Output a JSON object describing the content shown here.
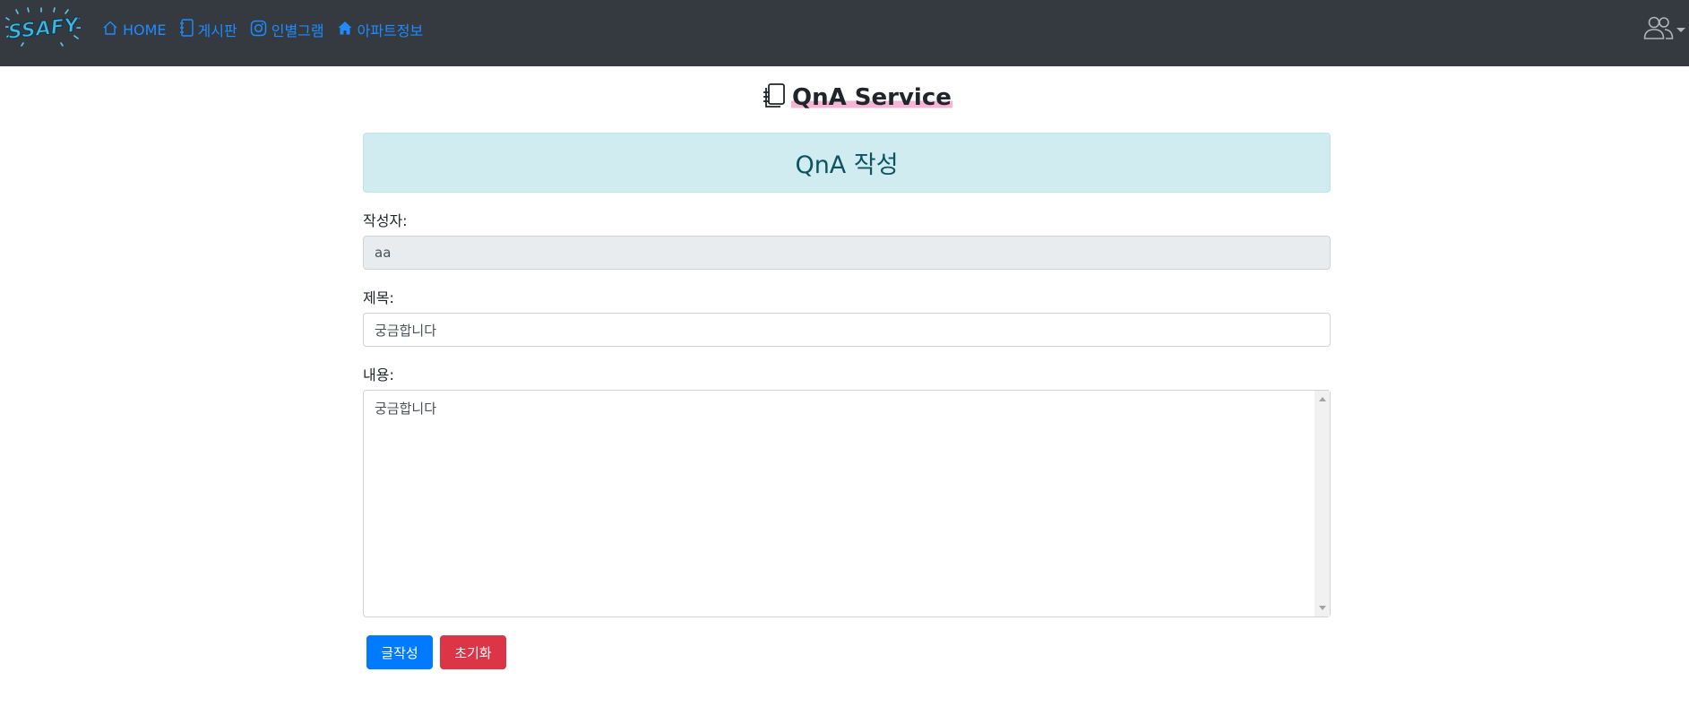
{
  "navbar": {
    "logo_text": "SSAFY",
    "links": [
      {
        "label": "HOME",
        "icon": "house-icon"
      },
      {
        "label": "게시판",
        "icon": "notebook-icon"
      },
      {
        "label": "인별그램",
        "icon": "instagram-icon"
      },
      {
        "label": "아파트정보",
        "icon": "house-fill-icon"
      }
    ],
    "user_icon": "people-icon"
  },
  "page": {
    "title": "QnA Service",
    "title_icon": "journals-icon"
  },
  "form": {
    "header": "QnA 작성",
    "writer_label": "작성자:",
    "writer_value": "aa",
    "subject_label": "제목:",
    "subject_value": "궁금합니다",
    "content_label": "내용:",
    "content_value": "궁금합니다",
    "submit_label": "글작성",
    "reset_label": "초기화"
  },
  "colors": {
    "navbar_bg": "#343a40",
    "link": "#1f8bff",
    "alert_bg": "#d1ecf1",
    "alert_text": "#0c5460",
    "primary": "#007bff",
    "danger": "#dc3545",
    "title_highlight": "#f4b6d6"
  }
}
